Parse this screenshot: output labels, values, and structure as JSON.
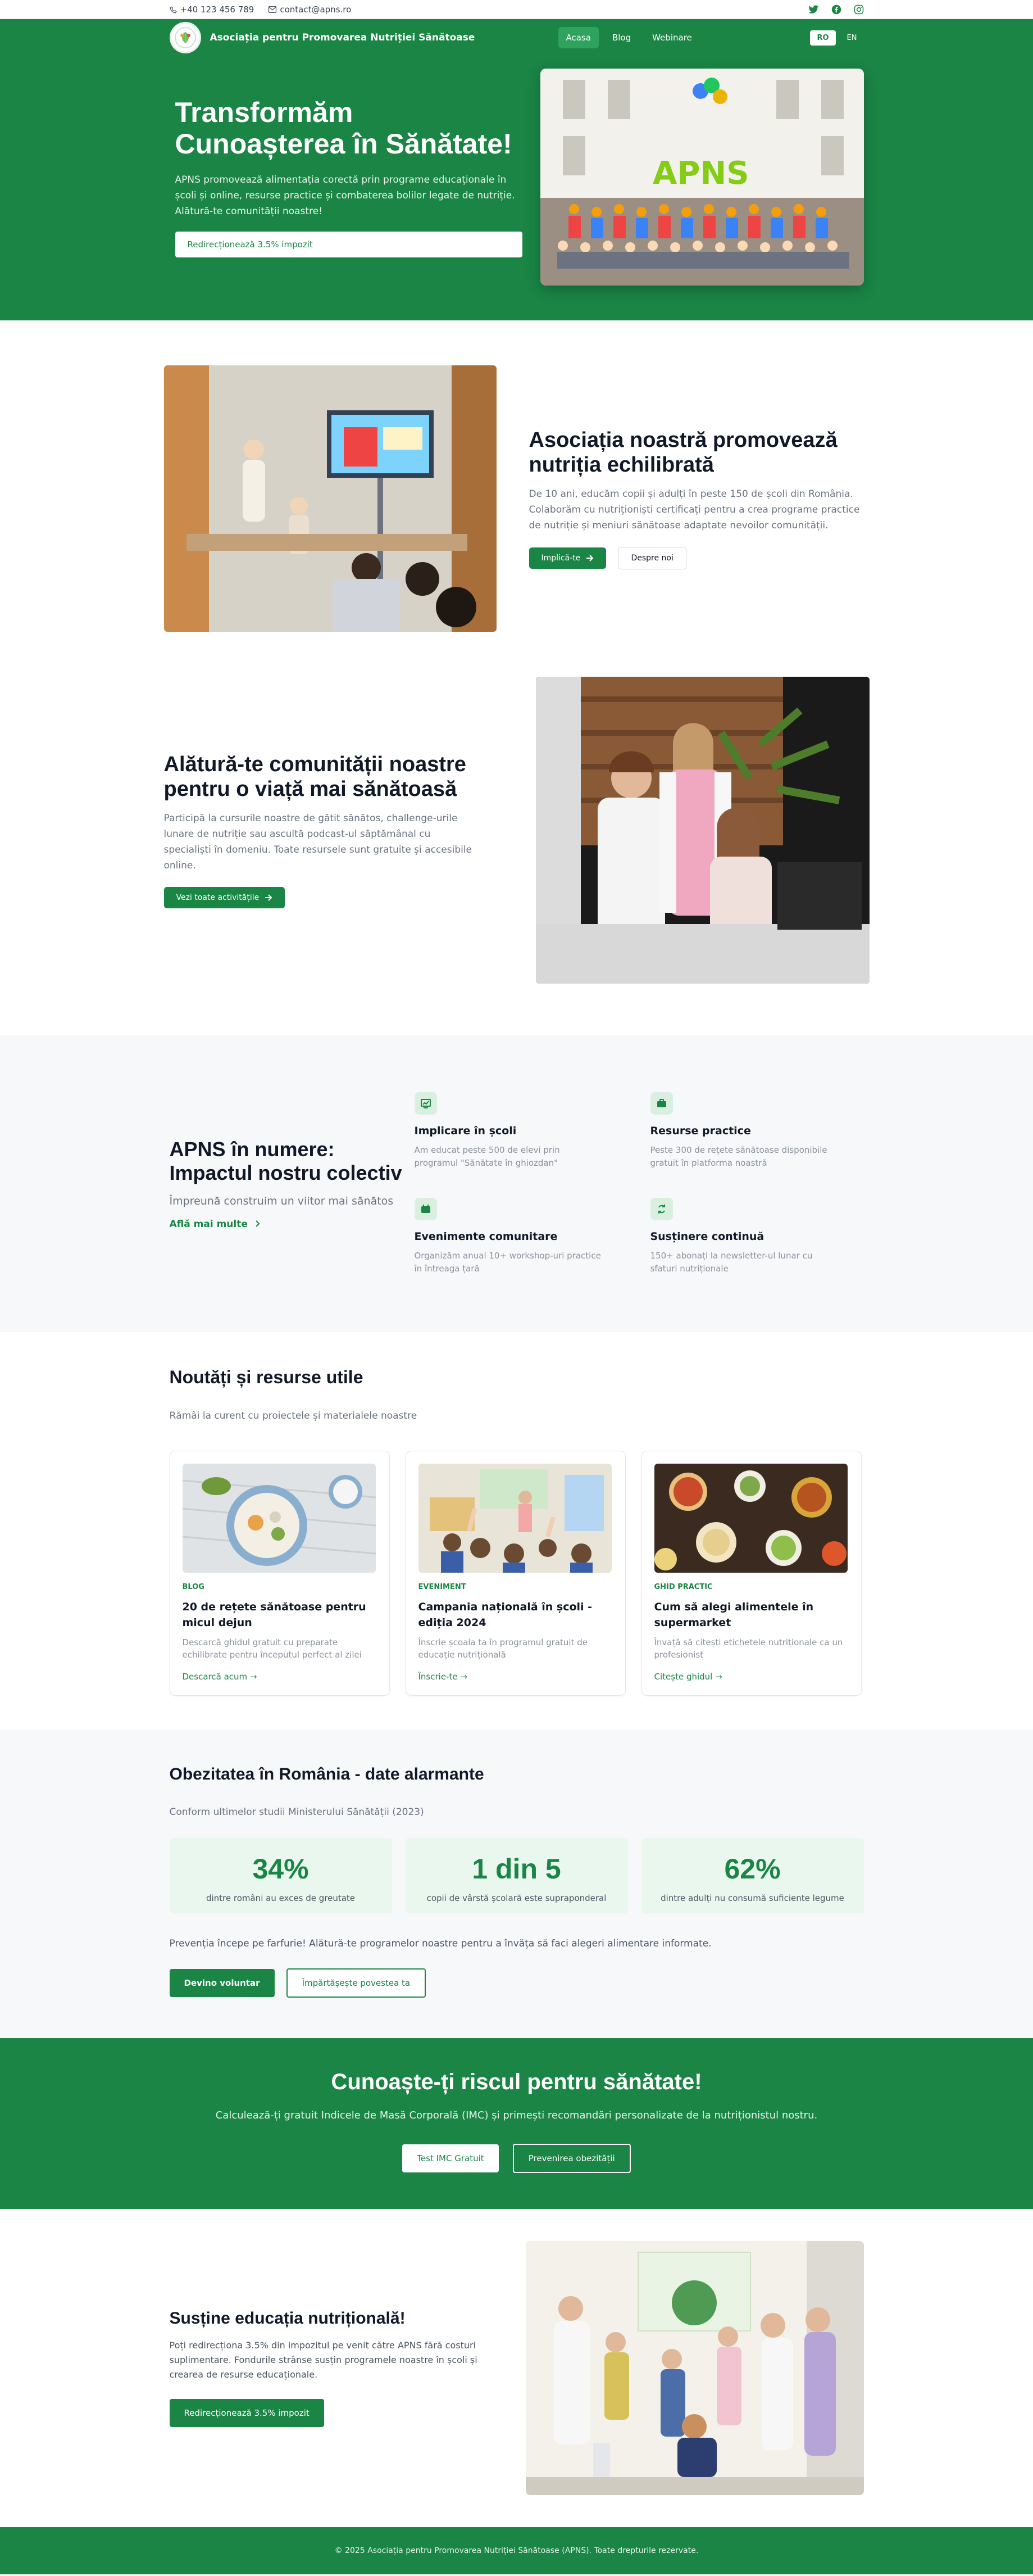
{
  "topbar": {
    "phone": "+40 123 456 789",
    "email": "contact@apns.ro",
    "social_icons": [
      "twitter-icon",
      "facebook-icon",
      "instagram-icon"
    ]
  },
  "nav": {
    "brand": "Asociația pentru Promovarea Nutriției Sănătoase",
    "links": [
      "Acasa",
      "Blog",
      "Webinare"
    ],
    "active": "Acasa",
    "lang": [
      "RO",
      "EN"
    ],
    "lang_active": "RO"
  },
  "hero": {
    "title": "Transformăm Cunoașterea în Sănătate!",
    "text": "APNS promovează alimentația corectă prin programe educaționale în școli și online, resurse practice și combaterea bolilor legate de nutriție. Alătură-te comunității noastre!",
    "button": "Redirecționează 3.5% impozit",
    "photo_sign": "APNS"
  },
  "feature1": {
    "title": "Asociația noastră promovează nutriția echilibrată",
    "text": "De 10 ani, educăm copii și adulți în peste 150 de școli din România. Colaborăm cu nutriționiști certificați pentru a crea programe practice de nutriție și meniuri sănătoase adaptate nevoilor comunității.",
    "btn_primary": "Implică-te",
    "btn_secondary": "Despre noi"
  },
  "feature2": {
    "title": "Alătură-te comunității noastre pentru o viață mai sănătoasă",
    "text": "Participă la cursurile noastre de gătit sănătos, challenge-urile lunare de nutriție sau ascultă podcast-ul săptămânal cu specialiști în domeniu. Toate resursele sunt gratuite și accesibile online.",
    "button": "Vezi toate activitățile"
  },
  "numbers": {
    "title": "APNS în numere: Impactul nostru colectiv",
    "subtitle": "Împreună construim un viitor mai sănătos",
    "link": "Află mai multe",
    "items": [
      {
        "icon": "chart-icon",
        "title": "Implicare în școli",
        "text": "Am educat peste 500 de elevi prin programul \"Sănătate în ghiozdan\""
      },
      {
        "icon": "briefcase-icon",
        "title": "Resurse practice",
        "text": "Peste 300 de rețete sănătoase disponibile gratuit în platforma noastră"
      },
      {
        "icon": "calendar-icon",
        "title": "Evenimente comunitare",
        "text": "Organizăm anual 10+ workshop-uri practice în întreaga țară"
      },
      {
        "icon": "refresh-icon",
        "title": "Susținere continuă",
        "text": "150+ abonați la newsletter-ul lunar cu sfaturi nutriționale"
      }
    ]
  },
  "news": {
    "title": "Noutăți și resurse utile",
    "subtitle": "Rămâi la curent cu proiectele și materialele noastre",
    "cards": [
      {
        "tag": "BLOG",
        "title": "20 de rețete sănătoase pentru micul dejun",
        "text": "Descarcă ghidul gratuit cu preparate echilibrate pentru începutul perfect al zilei",
        "link": "Descarcă acum →"
      },
      {
        "tag": "EVENIMENT",
        "title": "Campania națională în școli - ediția 2024",
        "text": "Înscrie școala ta în programul gratuit de educație nutrițională",
        "link": "Înscrie-te →"
      },
      {
        "tag": "GHID PRACTIC",
        "title": "Cum să alegi alimentele în supermarket",
        "text": "Învață să citești etichetele nutriționale ca un profesionist",
        "link": "Citește ghidul →"
      }
    ]
  },
  "obesity": {
    "title": "Obezitatea în România - date alarmante",
    "subtitle": "Conform ultimelor studii Ministerului Sănătății (2023)",
    "stats": [
      {
        "value": "34%",
        "label": "dintre români au exces de greutate"
      },
      {
        "value": "1 din 5",
        "label": "copii de vârstă școlară este supraponderal"
      },
      {
        "value": "62%",
        "label": "dintre adulți nu consumă suficiente legume"
      }
    ],
    "cta": "Prevenția începe pe farfurie! Alătură-te programelor noastre pentru a învăța să faci alegeri alimentare informate.",
    "btn_primary": "Devino voluntar",
    "btn_secondary": "Împărtășește povestea ta"
  },
  "risk": {
    "title": "Cunoaște-ți riscul pentru sănătate!",
    "text": "Calculează-ți gratuit Indicele de Masă Corporală (IMC) și primești recomandări personalizate de la nutriționistul nostru.",
    "btn_primary": "Test IMC Gratuit",
    "btn_secondary": "Prevenirea obezității"
  },
  "support": {
    "title": "Susține educația nutrițională!",
    "text": "Poți redirecționa 3.5% din impozitul pe venit către APNS fără costuri suplimentare. Fondurile strânse susțin programele noastre în școli și crearea de resurse educaționale.",
    "button": "Redirecționează 3.5% impozit"
  },
  "footer": {
    "text": "© 2025 Asociația pentru Promovarea Nutriției Sănătoase (APNS). Toate drepturile rezervate."
  },
  "colors": {
    "brand_green": "#1a8545",
    "active_nav": "#2ea35e",
    "stat_bg": "#eaf7ee"
  }
}
